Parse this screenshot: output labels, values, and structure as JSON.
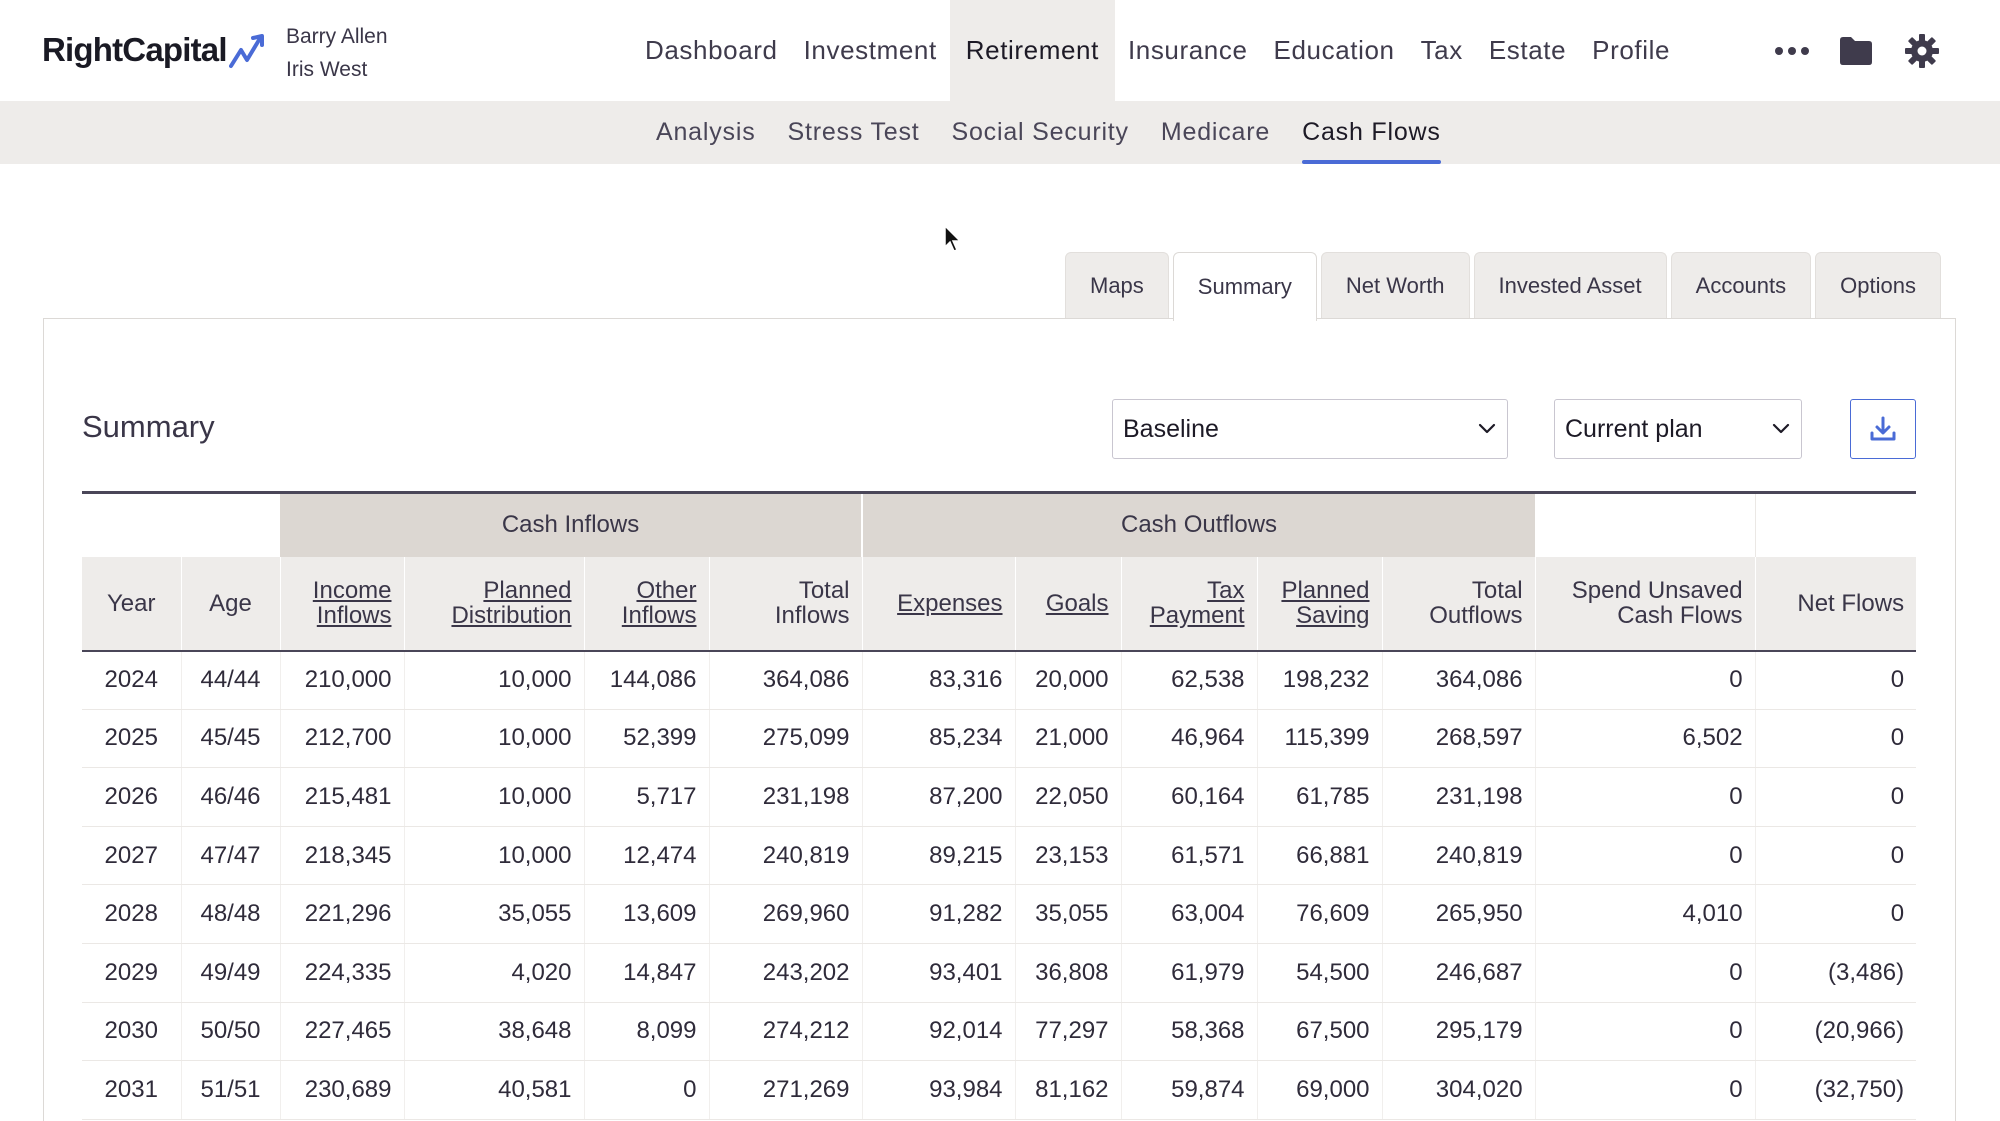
{
  "brand": {
    "name": "RightCapital",
    "accent": "#4a6bd6"
  },
  "clients": [
    "Barry Allen",
    "Iris West"
  ],
  "main_nav": [
    {
      "label": "Dashboard",
      "active": false
    },
    {
      "label": "Investment",
      "active": false
    },
    {
      "label": "Retirement",
      "active": true
    },
    {
      "label": "Insurance",
      "active": false
    },
    {
      "label": "Education",
      "active": false
    },
    {
      "label": "Tax",
      "active": false
    },
    {
      "label": "Estate",
      "active": false
    },
    {
      "label": "Profile",
      "active": false
    }
  ],
  "nav_icons": [
    "more-icon",
    "folder-icon",
    "gear-icon"
  ],
  "sub_nav": [
    {
      "label": "Analysis",
      "active": false
    },
    {
      "label": "Stress Test",
      "active": false
    },
    {
      "label": "Social Security",
      "active": false
    },
    {
      "label": "Medicare",
      "active": false
    },
    {
      "label": "Cash Flows",
      "active": true
    }
  ],
  "tabs": [
    {
      "label": "Maps",
      "active": false
    },
    {
      "label": "Summary",
      "active": true
    },
    {
      "label": "Net Worth",
      "active": false
    },
    {
      "label": "Invested Asset",
      "active": false
    },
    {
      "label": "Accounts",
      "active": false
    },
    {
      "label": "Options",
      "active": false
    }
  ],
  "summary": {
    "title": "Summary",
    "scenario_select": {
      "value": "Baseline"
    },
    "plan_select": {
      "value": "Current plan"
    },
    "download_icon": "download-icon"
  },
  "table": {
    "groups": {
      "inflows": "Cash Inflows",
      "outflows": "Cash Outflows"
    },
    "columns": [
      {
        "label": "Year",
        "link": false
      },
      {
        "label": "Age",
        "link": false
      },
      {
        "label": "Income Inflows",
        "link": true
      },
      {
        "label": "Planned Distribution",
        "link": true
      },
      {
        "label": "Other Inflows",
        "link": true
      },
      {
        "label": "Total Inflows",
        "link": false
      },
      {
        "label": "Expenses",
        "link": true
      },
      {
        "label": "Goals",
        "link": true
      },
      {
        "label": "Tax Payment",
        "link": true
      },
      {
        "label": "Planned Saving",
        "link": true
      },
      {
        "label": "Total Outflows",
        "link": false
      },
      {
        "label": "Spend Unsaved Cash Flows",
        "link": false
      },
      {
        "label": "Net Flows",
        "link": false
      }
    ],
    "rows": [
      [
        "2024",
        "44/44",
        "210,000",
        "10,000",
        "144,086",
        "364,086",
        "83,316",
        "20,000",
        "62,538",
        "198,232",
        "364,086",
        "0",
        "0"
      ],
      [
        "2025",
        "45/45",
        "212,700",
        "10,000",
        "52,399",
        "275,099",
        "85,234",
        "21,000",
        "46,964",
        "115,399",
        "268,597",
        "6,502",
        "0"
      ],
      [
        "2026",
        "46/46",
        "215,481",
        "10,000",
        "5,717",
        "231,198",
        "87,200",
        "22,050",
        "60,164",
        "61,785",
        "231,198",
        "0",
        "0"
      ],
      [
        "2027",
        "47/47",
        "218,345",
        "10,000",
        "12,474",
        "240,819",
        "89,215",
        "23,153",
        "61,571",
        "66,881",
        "240,819",
        "0",
        "0"
      ],
      [
        "2028",
        "48/48",
        "221,296",
        "35,055",
        "13,609",
        "269,960",
        "91,282",
        "35,055",
        "63,004",
        "76,609",
        "265,950",
        "4,010",
        "0"
      ],
      [
        "2029",
        "49/49",
        "224,335",
        "4,020",
        "14,847",
        "243,202",
        "93,401",
        "36,808",
        "61,979",
        "54,500",
        "246,687",
        "0",
        "(3,486)"
      ],
      [
        "2030",
        "50/50",
        "227,465",
        "38,648",
        "8,099",
        "274,212",
        "92,014",
        "77,297",
        "58,368",
        "67,500",
        "295,179",
        "0",
        "(20,966)"
      ],
      [
        "2031",
        "51/51",
        "230,689",
        "40,581",
        "0",
        "271,269",
        "93,984",
        "81,162",
        "59,874",
        "69,000",
        "304,020",
        "0",
        "(32,750)"
      ]
    ]
  }
}
